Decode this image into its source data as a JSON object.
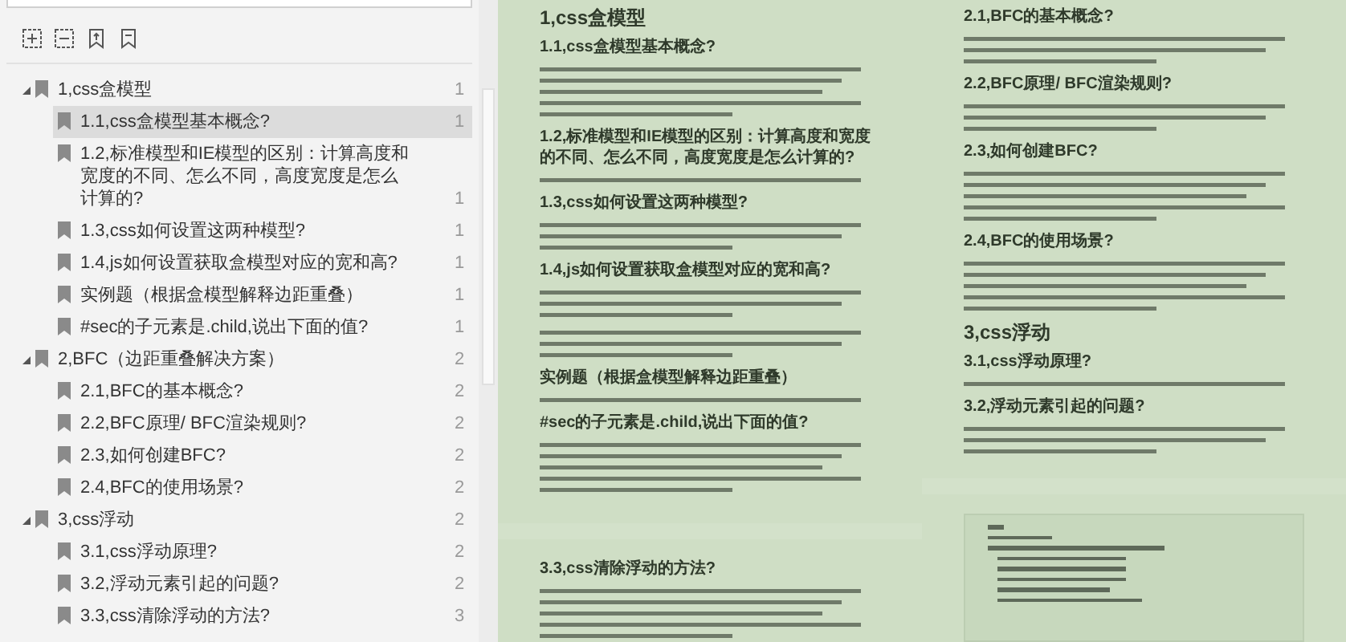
{
  "toolbar": {
    "buttons": [
      {
        "kind": "expand"
      },
      {
        "kind": "collapse"
      },
      {
        "kind": "bookmark-up"
      },
      {
        "kind": "bookmark-down"
      }
    ]
  },
  "outline": {
    "items": [
      {
        "label": "1,css盒模型",
        "page": "1",
        "selected": false,
        "expanded": true,
        "children": [
          {
            "label": "1.1,css盒模型基本概念?",
            "page": "1",
            "selected": true
          },
          {
            "label": "1.2,标准模型和IE模型的区别：计算高度和宽度的不同、怎么不同，高度宽度是怎么计算的?",
            "page": "1",
            "selected": false
          },
          {
            "label": "1.3,css如何设置这两种模型?",
            "page": "1",
            "selected": false
          },
          {
            "label": "1.4,js如何设置获取盒模型对应的宽和高?",
            "page": "1",
            "selected": false
          },
          {
            "label": "实例题（根据盒模型解释边距重叠）",
            "page": "1",
            "selected": false
          },
          {
            "label": "#sec的子元素是.child,说出下面的值?",
            "page": "1",
            "selected": false
          }
        ]
      },
      {
        "label": "2,BFC（边距重叠解决方案）",
        "page": "2",
        "selected": false,
        "expanded": true,
        "children": [
          {
            "label": "2.1,BFC的基本概念?",
            "page": "2",
            "selected": false
          },
          {
            "label": "2.2,BFC原理/ BFC渲染规则?",
            "page": "2",
            "selected": false
          },
          {
            "label": "2.3,如何创建BFC?",
            "page": "2",
            "selected": false
          },
          {
            "label": "2.4,BFC的使用场景?",
            "page": "2",
            "selected": false
          }
        ]
      },
      {
        "label": "3,css浮动",
        "page": "2",
        "selected": false,
        "expanded": true,
        "children": [
          {
            "label": "3.1,css浮动原理?",
            "page": "2",
            "selected": false
          },
          {
            "label": "3.2,浮动元素引起的问题?",
            "page": "2",
            "selected": false
          },
          {
            "label": "3.3,css清除浮动的方法?",
            "page": "3",
            "selected": false
          }
        ]
      }
    ]
  },
  "document": {
    "columns": [
      {
        "pages": [
          {
            "blocks": [
              {
                "kind": "h1",
                "text": "1,css盒模型"
              },
              {
                "kind": "h2",
                "text": "1.1,css盒模型基本概念?"
              },
              {
                "kind": "list"
              },
              {
                "kind": "h2",
                "text": "1.2,标准模型和IE模型的区别：计算高度和宽度的不同、怎么不同，高度宽度是怎么计算的?"
              },
              {
                "kind": "line"
              },
              {
                "kind": "h2",
                "text": "1.3,css如何设置这两种模型?"
              },
              {
                "kind": "paragraph"
              },
              {
                "kind": "h2",
                "text": "1.4,js如何设置获取盒模型对应的宽和高?"
              },
              {
                "kind": "paragraph"
              },
              {
                "kind": "paragraph"
              },
              {
                "kind": "h2",
                "text": "实例题（根据盒模型解释边距重叠）"
              },
              {
                "kind": "line"
              },
              {
                "kind": "h2",
                "text": "#sec的子元素是.child,说出下面的值?"
              },
              {
                "kind": "list"
              }
            ]
          },
          {
            "blocks": [
              {
                "kind": "h2",
                "text": "3.3,css清除浮动的方法?"
              },
              {
                "kind": "list"
              }
            ]
          }
        ]
      },
      {
        "pages": [
          {
            "blocks": [
              {
                "kind": "h2",
                "text": "2.1,BFC的基本概念?"
              },
              {
                "kind": "paragraph"
              },
              {
                "kind": "h2",
                "text": "2.2,BFC原理/ BFC渲染规则?"
              },
              {
                "kind": "paragraph"
              },
              {
                "kind": "h2",
                "text": "2.3,如何创建BFC?"
              },
              {
                "kind": "list"
              },
              {
                "kind": "h2",
                "text": "2.4,BFC的使用场景?"
              },
              {
                "kind": "list"
              },
              {
                "kind": "h1",
                "text": "3,css浮动"
              },
              {
                "kind": "h2",
                "text": "3.1,css浮动原理?"
              },
              {
                "kind": "line"
              },
              {
                "kind": "h2",
                "text": "3.2,浮动元素引起的问题?"
              },
              {
                "kind": "paragraph"
              }
            ]
          },
          {
            "blocks": [
              {
                "kind": "code"
              }
            ]
          }
        ]
      }
    ]
  }
}
